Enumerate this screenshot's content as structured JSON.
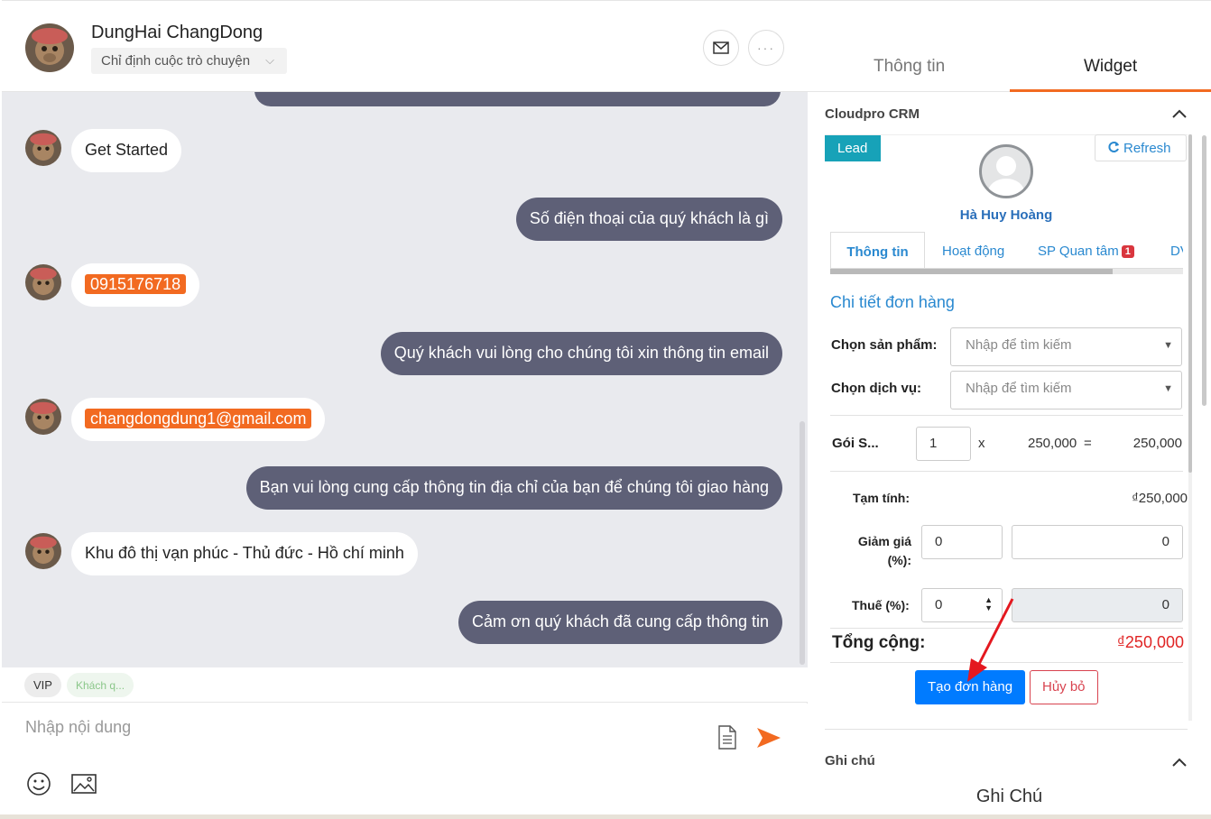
{
  "conversation": {
    "contact_name": "DungHai ChangDong",
    "assign_label": "Chỉ định cuộc trò chuyện",
    "messages": [
      {
        "from": "user",
        "text": "Get Started"
      },
      {
        "from": "bot",
        "text": "Số điện thoại của quý khách là gì"
      },
      {
        "from": "user",
        "text": "0915176718",
        "highlight": true
      },
      {
        "from": "bot",
        "text": "Quý khách vui lòng cho chúng tôi xin thông tin email"
      },
      {
        "from": "user",
        "text": "changdongdung1@gmail.com",
        "highlight": true
      },
      {
        "from": "bot",
        "text": "Bạn vui lòng cung cấp thông tin địa chỉ của bạn để chúng tôi giao hàng"
      },
      {
        "from": "user",
        "text": "Khu đô thị vạn phúc - Thủ đức - Hồ chí minh"
      },
      {
        "from": "bot",
        "text": "Cảm ơn quý khách đã cung cấp thông tin"
      }
    ],
    "tags": [
      "VIP",
      "Khách q..."
    ],
    "composer_placeholder": "Nhập nội dung",
    "bot_bubble_color": "#5e6077",
    "highlight_color": "#f26a21"
  },
  "side_tabs": {
    "info": "Thông tin",
    "widget": "Widget",
    "active": "Widget",
    "accent_color": "#f26a21"
  },
  "crm": {
    "section_title": "Cloudpro CRM",
    "lead_badge": "Lead",
    "refresh_label": "Refresh",
    "customer_name": "Hà Huy Hoàng",
    "tabs": [
      {
        "label": "Thông tin",
        "active": true
      },
      {
        "label": "Hoạt động"
      },
      {
        "label": "SP Quan tâm",
        "badge": "1"
      },
      {
        "label": "DV"
      }
    ],
    "order": {
      "title": "Chi tiết đơn hàng",
      "product_label": "Chọn sản phẩm:",
      "product_placeholder": "Nhập để tìm kiếm",
      "service_label": "Chọn dịch vụ:",
      "service_placeholder": "Nhập để tìm kiếm",
      "line_item": {
        "name": "Gói S...",
        "quantity": "1",
        "times": "x",
        "unit_price": "250,000",
        "equals": "=",
        "line_total": "250,000"
      },
      "subtotal_label": "Tạm tính:",
      "subtotal_value": "₫250,000",
      "discount_label_line1": "Giảm giá",
      "discount_label_line2": "(%):",
      "discount_percent": "0",
      "discount_amount": "0",
      "tax_label": "Thuế (%):",
      "tax_percent": "0",
      "tax_amount": "0",
      "total_label": "Tổng cộng:",
      "total_value": "₫250,000",
      "create_button": "Tạo đơn hàng",
      "cancel_button": "Hủy bỏ"
    }
  },
  "notes": {
    "section_title": "Ghi chú",
    "heading": "Ghi Chú"
  }
}
